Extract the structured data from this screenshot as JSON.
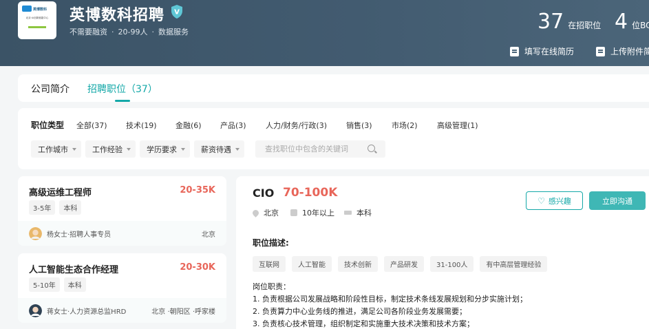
{
  "header": {
    "company_name": "英博数科招聘",
    "verified_badge": "V",
    "meta": [
      "不需要融资",
      "20-99人",
      "数据服务"
    ],
    "logo": {
      "brand": "英博数科",
      "subtitle": "北京·AI创新赋能中心"
    },
    "stats": [
      {
        "num": "37",
        "label": "在招职位"
      },
      {
        "num": "4",
        "label": "位BO"
      }
    ],
    "actions": [
      "填写在线简历",
      "上传附件简"
    ]
  },
  "tabs": [
    {
      "label": "公司简介",
      "active": false
    },
    {
      "label": "招聘职位（37）",
      "active": true
    }
  ],
  "filters": {
    "title": "职位类型",
    "categories": [
      "全部(37)",
      "技术(19)",
      "金融(6)",
      "产品(3)",
      "人力/财务/行政(3)",
      "销售(3)",
      "市场(2)",
      "高级管理(1)"
    ],
    "dropdowns": [
      "工作城市",
      "工作经验",
      "学历要求",
      "薪资待遇"
    ],
    "search_placeholder": "查找职位中包含的关键词"
  },
  "jobs": [
    {
      "title": "高级运维工程师",
      "salary": "20-35K",
      "tags": [
        "3-5年",
        "本科"
      ],
      "recruiter": "杨女士·招聘人事专员",
      "location": "北京"
    },
    {
      "title": "人工智能生态合作经理",
      "salary": "20-30K",
      "tags": [
        "5-10年",
        "本科"
      ],
      "recruiter": "蒋女士·人力资源总监HRD",
      "location": "北京 ·朝阳区 ·呼家楼"
    }
  ],
  "detail": {
    "title": "CIO",
    "salary": "70-100K",
    "meta": [
      "北京",
      "10年以上",
      "本科"
    ],
    "fav_label": "感兴趣",
    "chat_label": "立即沟通",
    "section_title": "职位描述:",
    "tags": [
      "互联网",
      "人工智能",
      "技术创新",
      "产品研发",
      "31-100人",
      "有中高层管理经验"
    ],
    "body": [
      "岗位职责：",
      "1. 负责根据公司发展战略和阶段性目标，制定技术条线发展规划和分步实施计划；",
      "2. 负责算力中心业务线的推进，满足公司各阶段业务发展需要；",
      "3. 负责核心技术管理，组织制定和实施重大技术决策和技术方案；"
    ]
  },
  "colors": {
    "accent": "#14a8a8",
    "salary": "#e8665a",
    "header_bg": "#425b70"
  }
}
